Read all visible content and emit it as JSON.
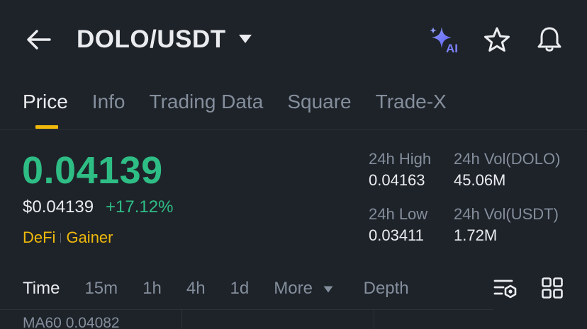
{
  "header": {
    "pair": "DOLO/USDT",
    "icons": [
      "back-arrow-icon",
      "caret-down-icon",
      "ai-sparkle-icon",
      "star-icon",
      "bell-icon"
    ]
  },
  "tabs": [
    {
      "label": "Price",
      "active": true
    },
    {
      "label": "Info",
      "active": false
    },
    {
      "label": "Trading Data",
      "active": false
    },
    {
      "label": "Square",
      "active": false
    },
    {
      "label": "Trade-X",
      "active": false
    }
  ],
  "price": {
    "last": "0.04139",
    "fiat": "$0.04139",
    "change": "+17.12%",
    "tags": [
      "DeFi",
      "Gainer"
    ]
  },
  "stats": {
    "high_label": "24h High",
    "high_value": "0.04163",
    "vol_base_label": "24h Vol(DOLO)",
    "vol_base_value": "45.06M",
    "low_label": "24h Low",
    "low_value": "0.03411",
    "vol_quote_label": "24h Vol(USDT)",
    "vol_quote_value": "1.72M"
  },
  "toolbar": {
    "timeframes": [
      "Time",
      "15m",
      "1h",
      "4h",
      "1d",
      "More"
    ],
    "depth": "Depth"
  },
  "chart": {
    "ma_label": "MA60 0.04082"
  },
  "colors": {
    "background": "#1e2329",
    "up": "#2ebd85",
    "accent": "#f0b90b",
    "muted": "#848e9c",
    "text": "#eaecef"
  }
}
